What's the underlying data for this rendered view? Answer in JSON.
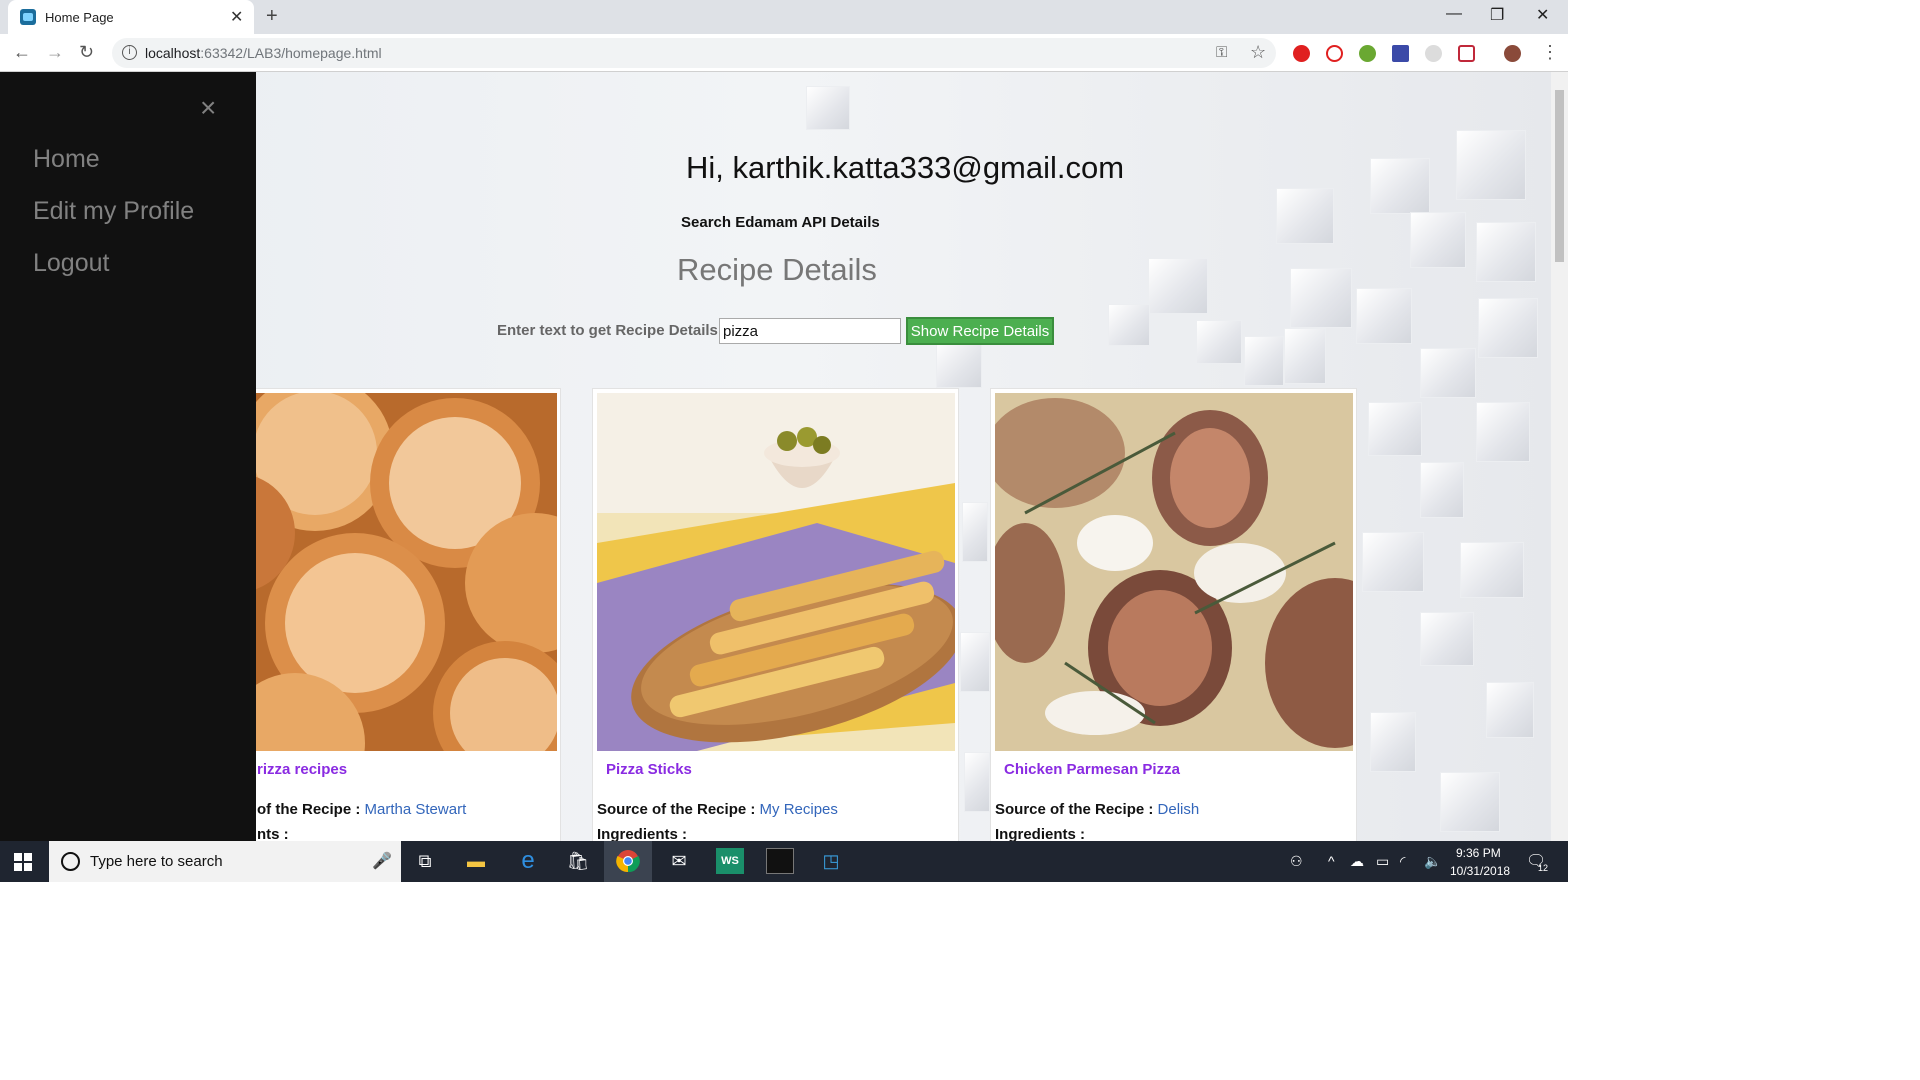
{
  "browser": {
    "tab_title": "Home Page",
    "url_host": "localhost",
    "url_path": ":63342/LAB3/homepage.html"
  },
  "sidebar": {
    "close_glyph": "×",
    "items": [
      {
        "label": "Home"
      },
      {
        "label": "Edit my Profile"
      },
      {
        "label": "Logout"
      }
    ]
  },
  "page": {
    "greeting": "Hi, karthik.katta333@gmail.com",
    "search_heading": "Search Edamam API Details",
    "recipe_heading": "Recipe Details",
    "input_label": "Enter text to get Recipe Details :",
    "input_value": "pizza",
    "button_label": "Show Recipe Details"
  },
  "cards": [
    {
      "title": "rizza recipes",
      "source_label": "of the Recipe :",
      "source_value": "Martha Stewart",
      "ingredients_label": "nts :",
      "image": "sugared-doughnut-balls"
    },
    {
      "title": "Pizza Sticks",
      "source_label": "Source of the Recipe :",
      "source_value": "My Recipes",
      "ingredients_label": "Ingredients :",
      "image": "pizza-sticks-board"
    },
    {
      "title": "Chicken Parmesan Pizza",
      "source_label": "Source of the Recipe :",
      "source_value": "Delish",
      "ingredients_label": "Ingredients :",
      "image": "fig-rosemary-pizza"
    }
  ],
  "taskbar": {
    "search_placeholder": "Type here to search",
    "time": "9:36 PM",
    "date": "10/31/2018",
    "notification_count": "12"
  },
  "colors": {
    "sidebar_bg": "#111111",
    "sidebar_link": "#818181",
    "button_green": "#4caf50",
    "card_title": "#8a2be2",
    "source_link": "#3366bb"
  }
}
